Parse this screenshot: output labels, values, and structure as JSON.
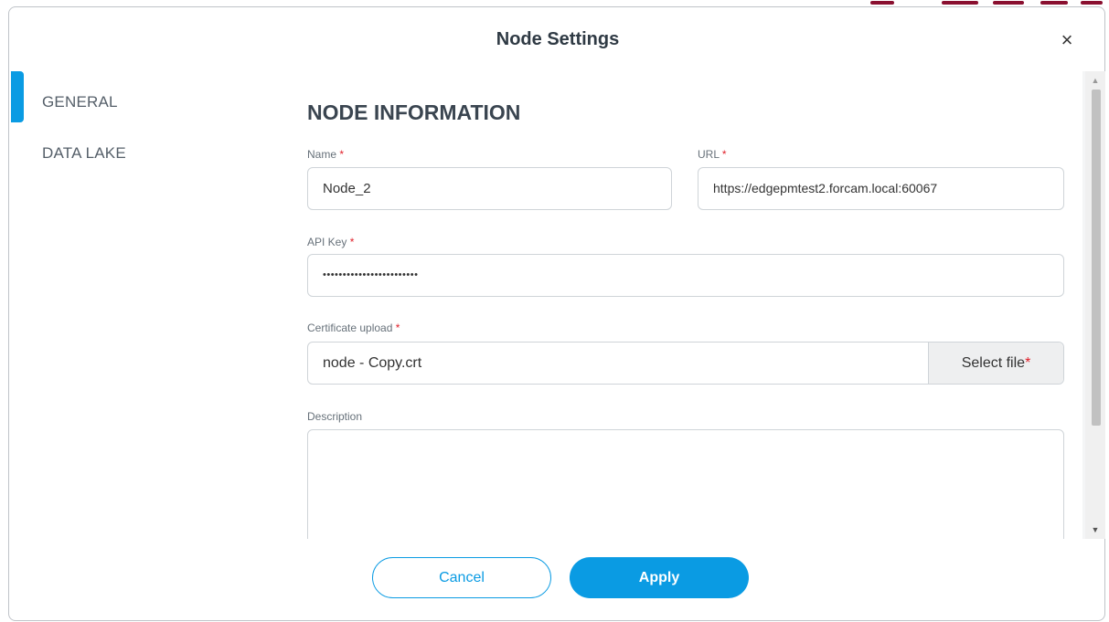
{
  "dialog": {
    "title": "Node Settings",
    "close_symbol": "×"
  },
  "sidebar": {
    "items": [
      {
        "label": "GENERAL",
        "active": true
      },
      {
        "label": "DATA LAKE",
        "active": false
      }
    ]
  },
  "form": {
    "section_title": "NODE INFORMATION",
    "required_marker": "*",
    "name": {
      "label": "Name",
      "value": "Node_2"
    },
    "url": {
      "label": "URL",
      "value": "https://edgepmtest2.forcam.local:60067"
    },
    "api_key": {
      "label": "API Key",
      "value": "••••••••••••••••••••••••"
    },
    "certificate": {
      "label": "Certificate upload",
      "value": "node - Copy.crt",
      "button_label": "Select file"
    },
    "description": {
      "label": "Description",
      "value": ""
    }
  },
  "footer": {
    "cancel_label": "Cancel",
    "apply_label": "Apply"
  },
  "colors": {
    "accent": "#0a9be3",
    "required": "#e0202a",
    "text": "#333333"
  }
}
